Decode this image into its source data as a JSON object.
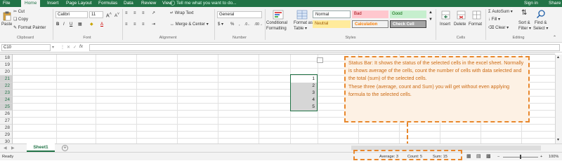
{
  "tabs": [
    "File",
    "Home",
    "Insert",
    "Page Layout",
    "Formulas",
    "Data",
    "Review",
    "View"
  ],
  "active_tab": "Home",
  "tell_me": "Tell me what you want to do...",
  "account": {
    "signin": "Sign in",
    "share": "Share"
  },
  "clipboard": {
    "paste": "Paste",
    "cut": "Cut",
    "copy": "Copy",
    "format_painter": "Format Painter",
    "group": "Clipboard"
  },
  "font": {
    "name": "Calibri",
    "size": "11",
    "group": "Font"
  },
  "alignment": {
    "wrap": "Wrap Text",
    "merge": "Merge & Center",
    "group": "Alignment"
  },
  "number": {
    "format": "General",
    "group": "Number"
  },
  "styles": {
    "conditional": [
      "Conditional",
      "Formatting"
    ],
    "format_table": [
      "Format as",
      "Table"
    ],
    "normal": "Normal",
    "bad": "Bad",
    "good": "Good",
    "neutral": "Neutral",
    "calculation": "Calculation",
    "check_cell": "Check Cell",
    "group": "Styles"
  },
  "cells": {
    "insert": "Insert",
    "delete": "Delete",
    "format": "Format",
    "group": "Cells"
  },
  "editing": {
    "autosum": "AutoSum",
    "fill": "Fill",
    "clear": "Clear",
    "sort": [
      "Sort &",
      "Filter"
    ],
    "find": [
      "Find &",
      "Select"
    ],
    "group": "Editing"
  },
  "formula_bar": {
    "name_box": "C10",
    "fx": "fx",
    "formula": ""
  },
  "rows": [
    "18",
    "19",
    "20",
    "21",
    "22",
    "23",
    "24",
    "25",
    "26",
    "27",
    "28",
    "29",
    "30"
  ],
  "selected_rows": [
    "21",
    "22",
    "23",
    "24",
    "25"
  ],
  "cell_values": [
    "1",
    "2",
    "3",
    "4",
    "5"
  ],
  "sheet": {
    "name": "Sheet1",
    "add": "+"
  },
  "status": {
    "ready": "Ready",
    "average": "Average: 3",
    "count": "Count: 5",
    "sum": "Sum: 15",
    "zoom": "100%"
  },
  "callout": {
    "para1": "Status Bar: It shows the status of the selected cells in the excel sheet. Normally is shows average of the cells, count the number of cells with data selected and the total (sum) of the selected cells.",
    "para2": "These three (average, count and Sum) you will get without even applying formula to the selected cells."
  },
  "colors": {
    "excel_green": "#217346",
    "callout_orange": "#e8872c",
    "bad_bg": "#ffc7ce",
    "good_bg": "#c6efce",
    "neutral_bg": "#ffeb9c"
  }
}
